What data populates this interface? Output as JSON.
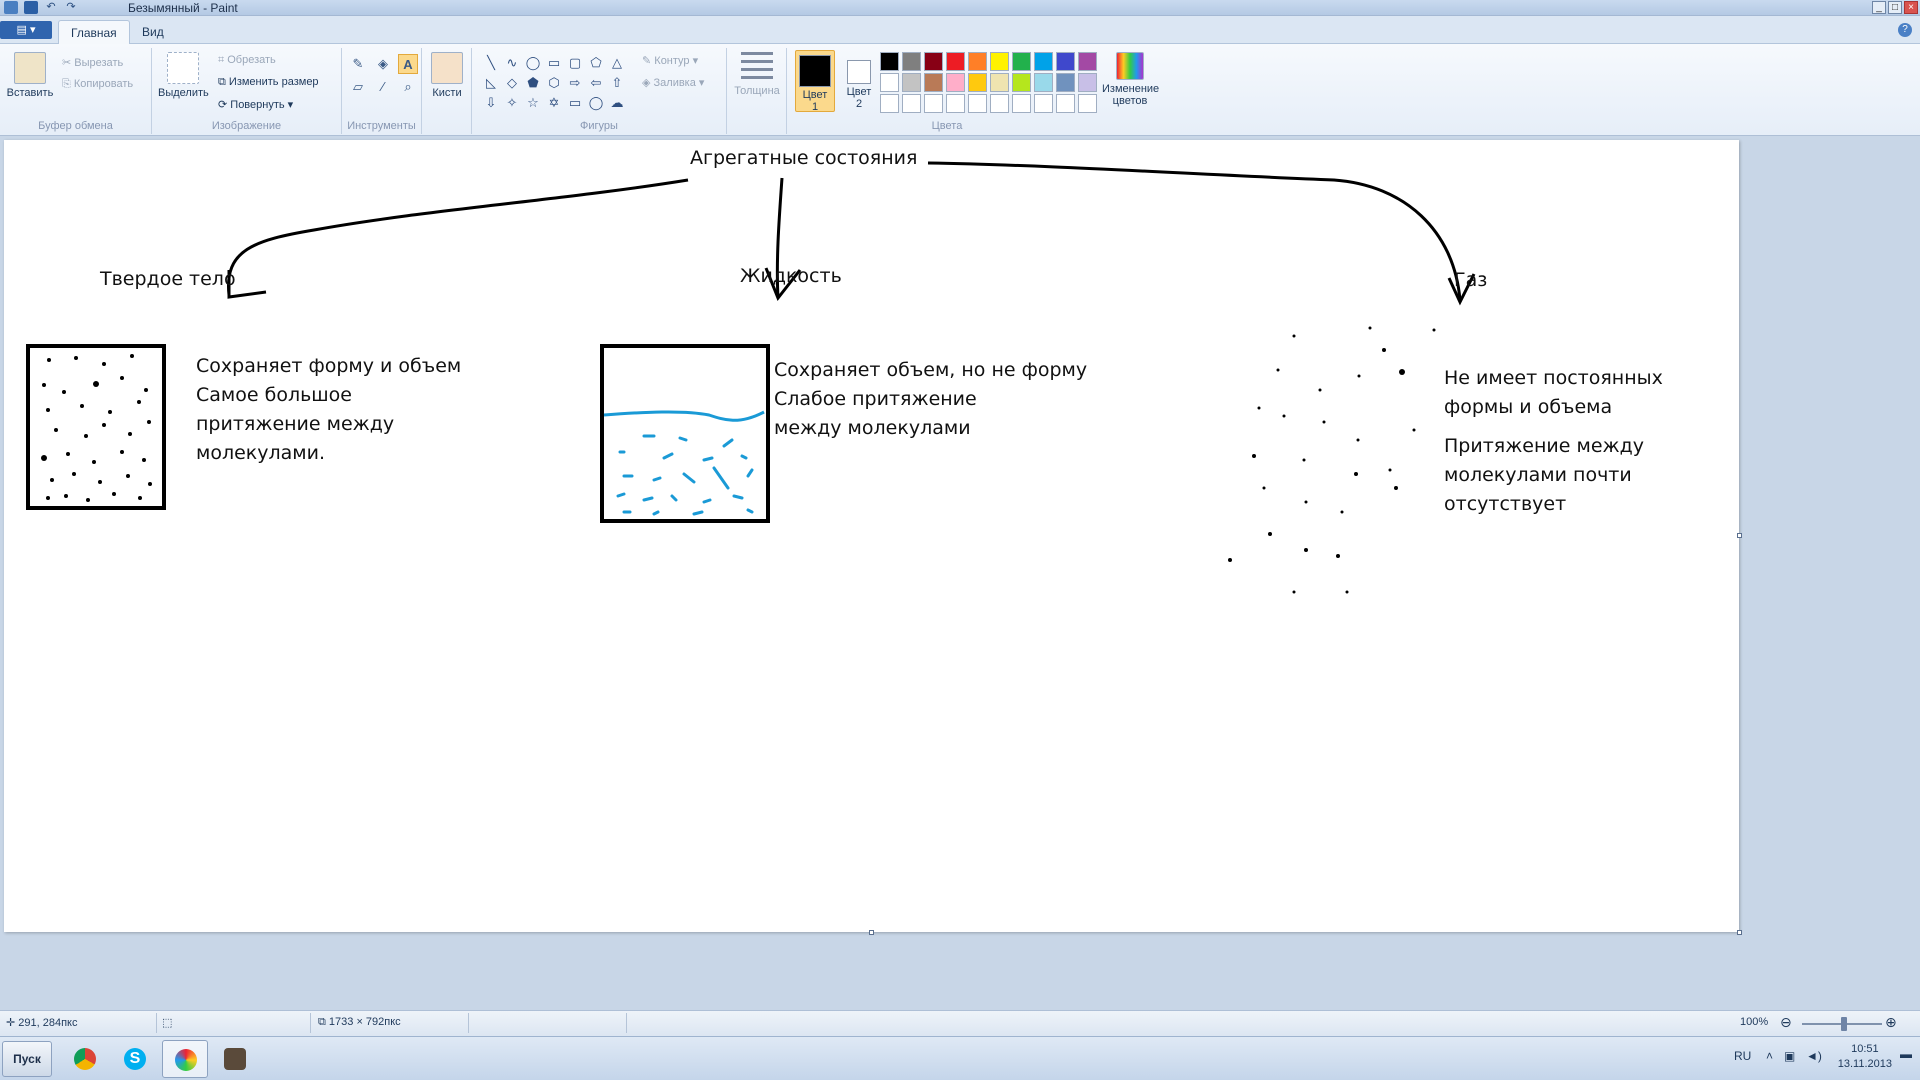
{
  "window": {
    "title": "Безымянный - Paint"
  },
  "tabs": [
    {
      "label": "Главная"
    },
    {
      "label": "Вид"
    }
  ],
  "clipboard": {
    "paste": "Вставить",
    "cut": "Вырезать",
    "copy": "Копировать",
    "label": "Буфер обмена"
  },
  "image": {
    "select": "Выделить",
    "crop": "Обрезать",
    "resize": "Изменить размер",
    "rotate": "Повернуть",
    "label": "Изображение"
  },
  "tools": {
    "label": "Инструменты",
    "brushes": "Кисти"
  },
  "shapes": {
    "label": "Фигуры",
    "outline": "Контур",
    "fill": "Заливка"
  },
  "size": {
    "label": "Толщина"
  },
  "colors": {
    "color1": "Цвет",
    "color1_num": "1",
    "color2": "Цвет",
    "color2_num": "2",
    "edit": "Изменение цветов",
    "label": "Цвета",
    "palette": [
      "#000000",
      "#7f7f7f",
      "#880015",
      "#ed1c24",
      "#ff7f27",
      "#fff200",
      "#22b14c",
      "#00a2e8",
      "#3f48cc",
      "#a349a4",
      "#ffffff",
      "#c3c3c3",
      "#b97a57",
      "#ffaec9",
      "#ffc90e",
      "#efe4b0",
      "#b5e61d",
      "#99d9ea",
      "#7092be",
      "#c8bfe7",
      "#ffffff",
      "#ffffff",
      "#ffffff",
      "#ffffff",
      "#ffffff",
      "#ffffff",
      "#ffffff",
      "#ffffff",
      "#ffffff",
      "#ffffff"
    ]
  },
  "drawing": {
    "title": "Агрегатные состояния",
    "solid": {
      "heading": "Твердое тело",
      "lines": [
        "Сохраняет форму и объем",
        "Самое большое",
        "притяжение между",
        "молекулами."
      ]
    },
    "liquid": {
      "heading": "Жидкость",
      "lines": [
        "Сохраняет объем, но не форму",
        "Слабое притяжение",
        "между молекулами"
      ]
    },
    "gas": {
      "heading": "Газ",
      "lines1": [
        "Не имеет постоянных",
        "формы и объема"
      ],
      "lines2": [
        "Притяжение между",
        "молекулами почти",
        "отсутствует"
      ]
    }
  },
  "status": {
    "cursor": "291, 284пкс",
    "size": "1733 × 792пкс",
    "zoom": "100%"
  },
  "taskbar": {
    "start": "Пуск",
    "lang": "RU",
    "time": "10:51",
    "date": "13.11.2013"
  }
}
